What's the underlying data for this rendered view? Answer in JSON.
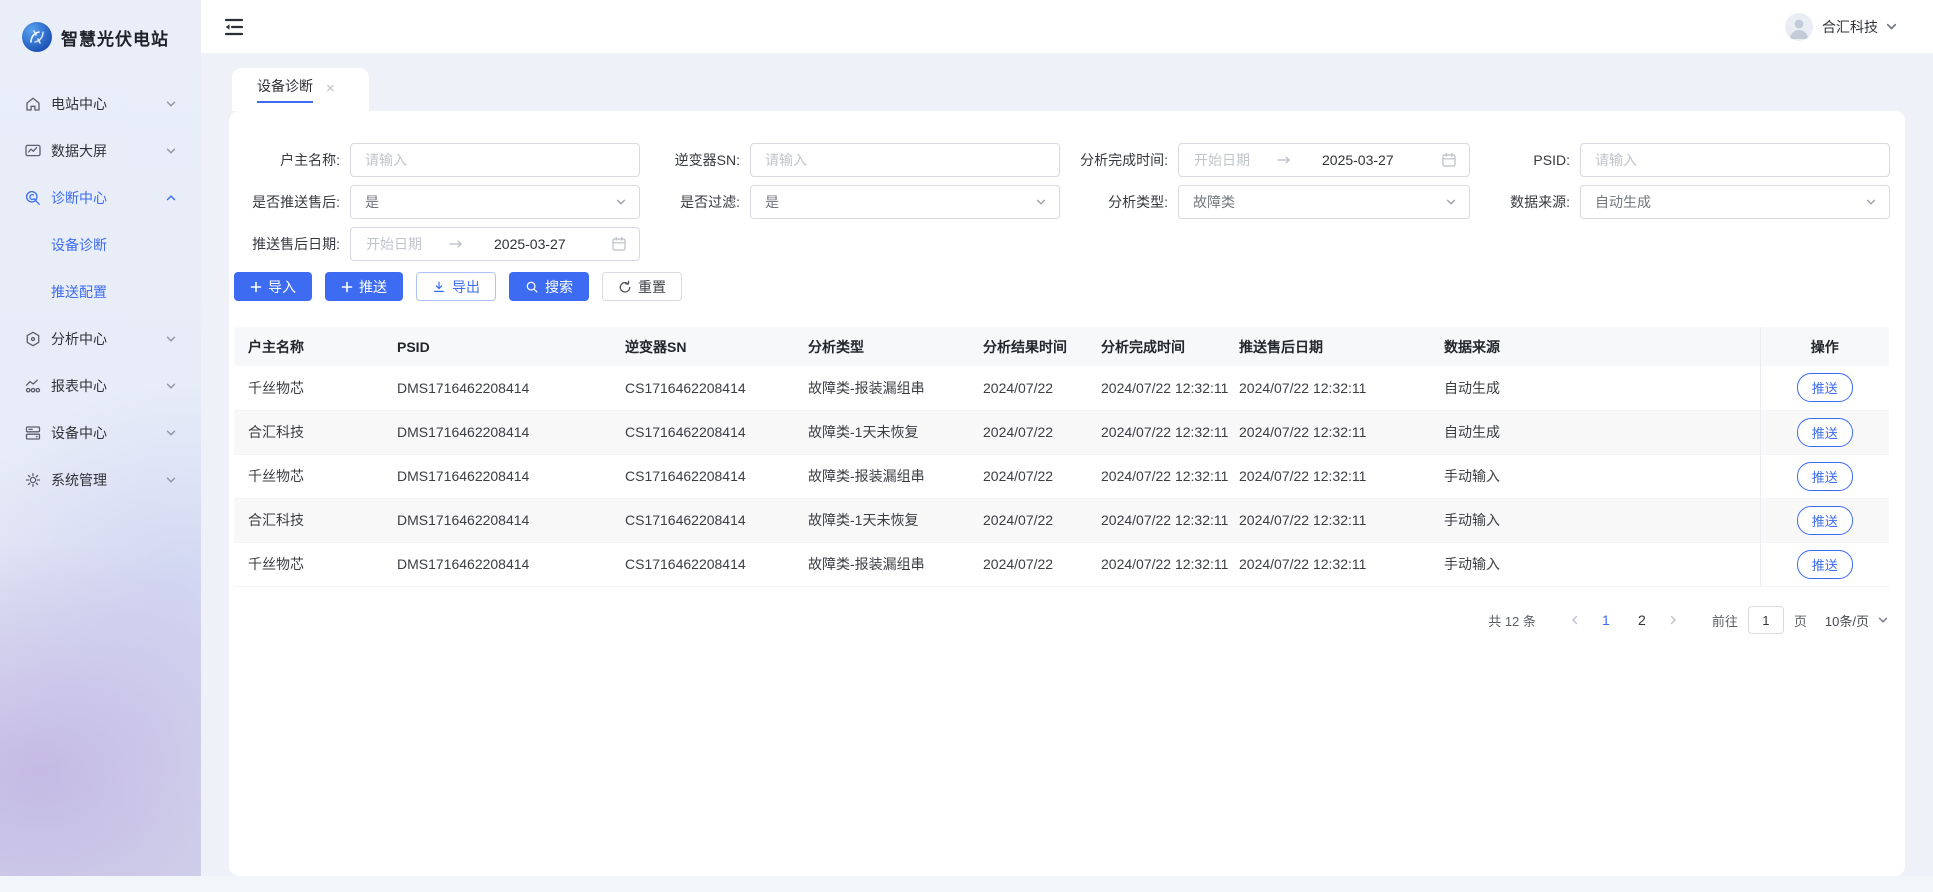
{
  "app": {
    "logo_text": "智慧光伏电站"
  },
  "topbar": {
    "user_name": "合汇科技"
  },
  "sidebar": {
    "items": [
      {
        "label": "电站中心"
      },
      {
        "label": "数据大屏"
      },
      {
        "label": "诊断中心"
      },
      {
        "label": "分析中心"
      },
      {
        "label": "报表中心"
      },
      {
        "label": "设备中心"
      },
      {
        "label": "系统管理"
      }
    ],
    "diagnosis_children": [
      {
        "label": "设备诊断"
      },
      {
        "label": "推送配置"
      }
    ]
  },
  "tab": {
    "label": "设备诊断",
    "close": "×"
  },
  "filters": {
    "owner_name": {
      "label": "户主名称:",
      "placeholder": "请输入"
    },
    "inverter_sn": {
      "label": "逆变器SN:",
      "placeholder": "请输入"
    },
    "analysis_complete_time": {
      "label": "分析完成时间:",
      "start_placeholder": "开始日期",
      "end_value": "2025-03-27"
    },
    "psid": {
      "label": "PSID:",
      "placeholder": "请输入"
    },
    "push_aftersales": {
      "label": "是否推送售后:",
      "value": "是"
    },
    "filtered": {
      "label": "是否过滤:",
      "value": "是"
    },
    "analysis_type": {
      "label": "分析类型:",
      "value": "故障类"
    },
    "data_source": {
      "label": "数据来源:",
      "value": "自动生成"
    },
    "push_aftersales_date": {
      "label": "推送售后日期:",
      "start_placeholder": "开始日期",
      "end_value": "2025-03-27"
    }
  },
  "toolbar": {
    "import_label": "导入",
    "push_label": "推送",
    "export_label": "导出",
    "search_label": "搜索",
    "reset_label": "重置"
  },
  "table": {
    "columns": [
      "户主名称",
      "PSID",
      "逆变器SN",
      "分析类型",
      "分析结果时间",
      "分析完成时间",
      "推送售后日期",
      "数据来源",
      "操作"
    ],
    "rows": [
      [
        "千丝物芯",
        "DMS1716462208414",
        "CS1716462208414",
        "故障类-报装漏组串",
        "2024/07/22",
        "2024/07/22 12:32:11",
        "2024/07/22 12:32:11",
        "自动生成"
      ],
      [
        "合汇科技",
        "DMS1716462208414",
        "CS1716462208414",
        "故障类-1天未恢复",
        "2024/07/22",
        "2024/07/22 12:32:11",
        "2024/07/22 12:32:11",
        "自动生成"
      ],
      [
        "千丝物芯",
        "DMS1716462208414",
        "CS1716462208414",
        "故障类-报装漏组串",
        "2024/07/22",
        "2024/07/22 12:32:11",
        "2024/07/22 12:32:11",
        "手动输入"
      ],
      [
        "合汇科技",
        "DMS1716462208414",
        "CS1716462208414",
        "故障类-1天未恢复",
        "2024/07/22",
        "2024/07/22 12:32:11",
        "2024/07/22 12:32:11",
        "手动输入"
      ],
      [
        "千丝物芯",
        "DMS1716462208414",
        "CS1716462208414",
        "故障类-报装漏组串",
        "2024/07/22",
        "2024/07/22 12:32:11",
        "2024/07/22 12:32:11",
        "手动输入"
      ]
    ],
    "row_action": "推送"
  },
  "pagination": {
    "total": "共 12 条",
    "pages": [
      "1",
      "2"
    ],
    "goto_label": "前往",
    "goto_value": "1",
    "page_unit": "页",
    "page_size": "10条/页"
  }
}
